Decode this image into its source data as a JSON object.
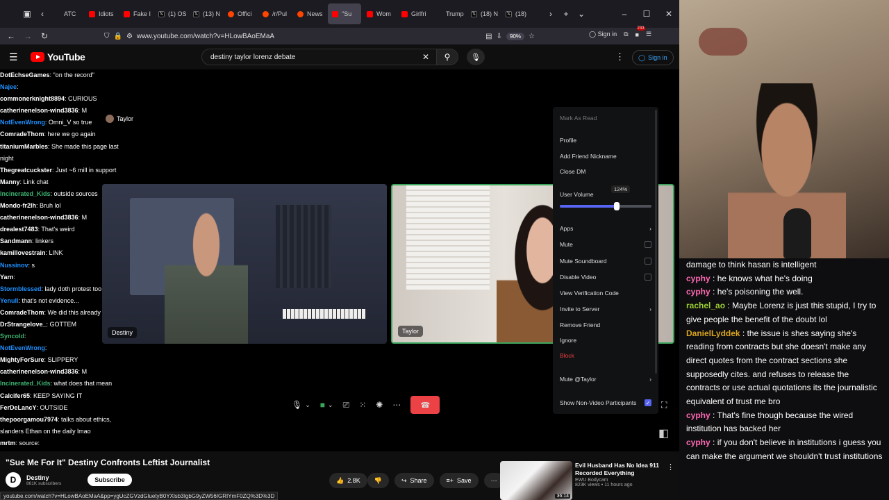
{
  "browser": {
    "tabs": [
      {
        "label": "ATC",
        "icon": "pinned"
      },
      {
        "label": "Idiots",
        "icon": "yt"
      },
      {
        "label": "Fake I",
        "icon": "yt"
      },
      {
        "label": "(1) OS",
        "icon": "x"
      },
      {
        "label": "(13) N",
        "icon": "x"
      },
      {
        "label": "Offici",
        "icon": "rd"
      },
      {
        "label": "/r/Pul",
        "icon": "rd"
      },
      {
        "label": "News",
        "icon": "rd"
      },
      {
        "label": "\"Su",
        "icon": "yt",
        "active": true
      },
      {
        "label": "Wom",
        "icon": "yt"
      },
      {
        "label": "Girlfri",
        "icon": "yt"
      },
      {
        "label": "Trump",
        "icon": "none"
      },
      {
        "label": "(18) N",
        "icon": "x"
      },
      {
        "label": "(18)",
        "icon": "x"
      }
    ],
    "url": "www.youtube.com/watch?v=HLowBAoEMaA",
    "zoom": "90%",
    "signin": "Sign in",
    "badge_count": "233"
  },
  "youtube": {
    "logo": "YouTube",
    "search_value": "destiny taylor lorenz debate",
    "signin": "Sign in",
    "video_title": "\"Sue Me For It\" Destiny Confronts Leftist Journalist",
    "channel_name": "Destiny",
    "subscribers": "861K subscribers",
    "subscribe": "Subscribe",
    "likes": "2.8K",
    "share": "Share",
    "save": "Save",
    "status_url": "youtube.com/watch?v=HLowBAoEMaA&pp=ygUcZGVzdGluetyB0YXlsb3IgbG9yZW56IGRIYmF0ZQ%3D%3D",
    "recommended": {
      "title": "Evil Husband Has No Idea 911 Recorded Everything",
      "channel": "EWU Bodycam",
      "meta": "823K views • 11 hours ago",
      "duration": "36:14"
    }
  },
  "stream_chat": [
    {
      "user": "DotEchseGames",
      "text": "\"on the record\"",
      "color": "#ffffff"
    },
    {
      "user": "Najee",
      "text": "",
      "color": "#1e90ff"
    },
    {
      "user": "commonerknight8894",
      "text": "CURIOUS",
      "color": "#ffffff"
    },
    {
      "user": "catherinenelson-wind3836",
      "text": "M",
      "color": "#ffffff"
    },
    {
      "user": "NotEvenWrong",
      "text": "Omni_V so true",
      "color": "#1e90ff"
    },
    {
      "user": "ComradeThom",
      "text": "here we go again",
      "color": "#ffffff"
    },
    {
      "user": "titaniumMarbles",
      "text": "She made this page last",
      "color": "#ffffff"
    },
    {
      "user": "",
      "text": "night",
      "color": "#ffffff"
    },
    {
      "user": "Thegreatcuckster",
      "text": "Just ~6 mill in support",
      "color": "#ffffff"
    },
    {
      "user": "",
      "text": "",
      "color": "#ffffff"
    },
    {
      "user": "Manny",
      "text": "Link chat",
      "color": "#ffffff"
    },
    {
      "user": "Incinerated_Kids",
      "text": "outside sources",
      "color": "#3cb371"
    },
    {
      "user": "Mondo-fr2lh",
      "text": "Bruh lol",
      "color": "#ffffff"
    },
    {
      "user": "catherinenelson-wind3836",
      "text": "M",
      "color": "#ffffff"
    },
    {
      "user": "drealest7483",
      "text": "That's weird",
      "color": "#ffffff"
    },
    {
      "user": "Sandmann",
      "text": "linkers",
      "color": "#ffffff"
    },
    {
      "user": "kamillovestrain",
      "text": "LINK",
      "color": "#ffffff"
    },
    {
      "user": "Nussinov",
      "text": "s",
      "color": "#1e90ff"
    },
    {
      "user": "Yarn",
      "text": "",
      "color": "#ffffff"
    },
    {
      "user": "Stormblessed",
      "text": "lady doth protest too much",
      "color": "#1e90ff"
    },
    {
      "user": "Yenull",
      "text": "that's not evidence...",
      "color": "#1e90ff"
    },
    {
      "user": "ComradeThom",
      "text": "We did this already",
      "color": "#ffffff"
    },
    {
      "user": "DrStrangelove_",
      "text": "GOTTEM",
      "color": "#ffffff"
    },
    {
      "user": "Syncold",
      "text": "",
      "color": "#3cb371"
    },
    {
      "user": "NotEvenWrong",
      "text": "",
      "color": "#1e90ff"
    },
    {
      "user": "MightyForSure",
      "text": "SLIPPERY",
      "color": "#ffffff"
    },
    {
      "user": "catherinenelson-wind3836",
      "text": "M",
      "color": "#ffffff"
    },
    {
      "user": "Incinerated_Kids",
      "text": "what does that mean",
      "color": "#3cb371"
    },
    {
      "user": "Calcifer65",
      "text": "KEEP SAYING IT",
      "color": "#ffffff"
    },
    {
      "user": "FerDeLancY",
      "text": "OUTSIDE",
      "color": "#ffffff"
    },
    {
      "user": "thepoorgamou7974",
      "text": "talks about ethics,",
      "color": "#ffffff"
    },
    {
      "user": "",
      "text": "slanders Ethan on the daily lmao",
      "color": "#ffffff"
    },
    {
      "user": "mrtm",
      "text": "source:",
      "color": "#ffffff"
    }
  ],
  "call": {
    "left_name": "Destiny",
    "right_name": "Taylor",
    "speaker_label": "Taylor"
  },
  "context_menu": {
    "mark_as_read": "Mark As Read",
    "profile": "Profile",
    "add_friend_nickname": "Add Friend Nickname",
    "close_dm": "Close DM",
    "user_volume": "User Volume",
    "volume_value": "124%",
    "volume_level": 0.62,
    "apps": "Apps",
    "mute": "Mute",
    "mute_soundboard": "Mute Soundboard",
    "disable_video": "Disable Video",
    "view_verification_code": "View Verification Code",
    "invite_to_server": "Invite to Server",
    "remove_friend": "Remove Friend",
    "ignore": "Ignore",
    "block": "Block",
    "mute_user": "Mute @Taylor",
    "show_non_video": "Show Non-Video Participants"
  },
  "twitch_chat": [
    {
      "user": "",
      "text": "damage to think hasan is intelligent",
      "color": "#ffffff"
    },
    {
      "user": "cyphy",
      "text": "he knows what he's doing",
      "color": "#ff69b4"
    },
    {
      "user": "cyphy",
      "text": "he's poisoning the well.",
      "color": "#ff69b4"
    },
    {
      "user": "rachel_ao",
      "text": "Maybe Lorenz is just this stupid, I try to give people the benefit of the doubt lol",
      "color": "#9acd32"
    },
    {
      "user": "DanielLyddek",
      "text": "the issue is shes saying she's reading from contracts but she doesn't make any direct quotes from the contract sections she supposedly cites. and refuses to release the contracts or use actual quotations its the journalistic equivalent of trust me bro",
      "color": "#daa520"
    },
    {
      "user": "cyphy",
      "text": "That's fine though because the wired institution has backed her",
      "color": "#ff69b4"
    },
    {
      "user": "cyphy",
      "text": "if you don't believe in institutions i guess you can make the argument we shouldn't trust institutions",
      "color": "#ff69b4"
    }
  ]
}
